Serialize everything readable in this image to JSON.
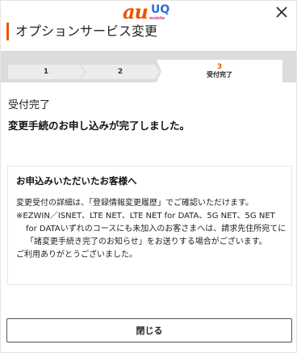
{
  "header": {
    "brand_au": "au",
    "brand_uq": "UQ",
    "brand_uq_sub": "mobile",
    "title": "オプションサービス変更",
    "accent_color": "#eb5505"
  },
  "steps": {
    "items": [
      {
        "number": "1",
        "label": ""
      },
      {
        "number": "2",
        "label": ""
      },
      {
        "number": "3",
        "label": "受付完了"
      }
    ],
    "current": 3
  },
  "status": {
    "title": "受付完了",
    "message": "変更手続のお申し込みが完了しました。"
  },
  "notice": {
    "title": "お申込みいただいたお客様へ",
    "line1": "変更受付の詳細は、「登録情報変更履歴」でご確認いただけます。",
    "line2": "※EZWIN／ISNET、LTE NET、LTE NET for DATA、5G NET、5G NET for DATAいずれのコースにも未加入のお客さまへは、請求先住所宛てに「諸変更手続き完了のお知らせ」をお送りする場合がございます。",
    "line3": "ご利用ありがとうございました。"
  },
  "actions": {
    "close_label": "閉じる"
  },
  "icons": {
    "close": "close-icon"
  }
}
